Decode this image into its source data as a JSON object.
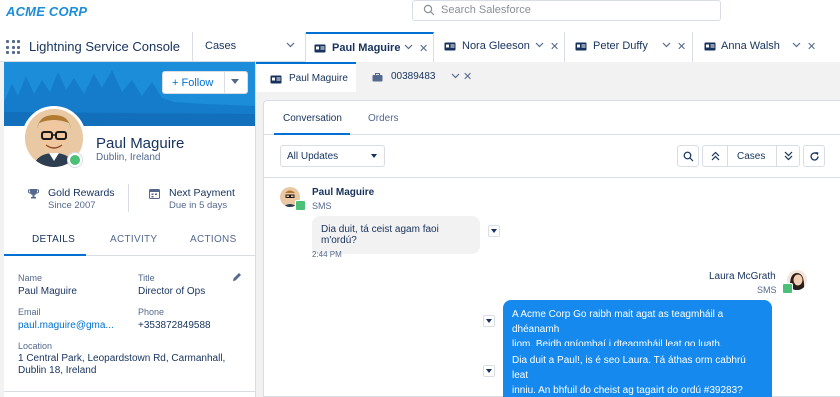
{
  "header": {
    "logo": "ACME CORP",
    "search_placeholder": "Search Salesforce"
  },
  "nav": {
    "app_name": "Lightning Service Console",
    "object_tab": "Cases",
    "tabs": [
      {
        "label": "Paul Maguire",
        "active": true
      },
      {
        "label": "Nora Gleeson",
        "active": false
      },
      {
        "label": "Peter Duffy",
        "active": false
      },
      {
        "label": "Anna Walsh",
        "active": false
      }
    ]
  },
  "profile": {
    "follow_label": "+ Follow",
    "name": "Paul Maguire",
    "location": "Dublin, Ireland",
    "stats": [
      {
        "title": "Gold Rewards",
        "sub": "Since 2007",
        "icon": "trophy-icon"
      },
      {
        "title": "Next Payment",
        "sub": "Due in 5 days",
        "icon": "calendar-icon"
      }
    ],
    "tabs": [
      "DETAILS",
      "ACTIVITY",
      "ACTIONS"
    ],
    "fields": {
      "name_label": "Name",
      "name_value": "Paul Maguire",
      "title_label": "Title",
      "title_value": "Director of Ops",
      "email_label": "Email",
      "email_value": "paul.maguire@gma...",
      "phone_label": "Phone",
      "phone_value": "+353872849588",
      "location_label": "Location",
      "location_line1": "1 Central Park, Leopardstown Rd, Carmanhall,",
      "location_line2": "Dublin 18, Ireland"
    }
  },
  "subtabs": [
    {
      "label": "Paul Maguire",
      "icon": "contact-card-icon"
    },
    {
      "label": "00389483",
      "icon": "case-briefcase-icon"
    }
  ],
  "conversation": {
    "tabs": [
      "Conversation",
      "Orders"
    ],
    "filter": "All Updates",
    "cases_label": "Cases",
    "messages": [
      {
        "sender": "Paul Maguire",
        "channel": "SMS",
        "text": "Dia duit, tá ceist agam faoi m'ordú?",
        "time": "2:44 PM"
      },
      {
        "sender": "Laura McGrath",
        "channel": "SMS",
        "text1_line1": "A Acme Corp Go raibh mait agat as teagmháil a dhéanamh",
        "text1_line2": "liom. Beidh gníomhaí i dteagmháil leat go luath.",
        "text2_line1": "Dia duit a Paul!, is é seo Laura. Tá áthas orm cabhrú leat",
        "text2_line2": "inniu. An bhfuil do cheist ag tagairt do ordú  #39283?"
      }
    ]
  },
  "colors": {
    "brand": "#1b8dd9",
    "accent": "#0070d2",
    "sms": "#4bc076",
    "outgoing_bubble": "#1589ee"
  }
}
